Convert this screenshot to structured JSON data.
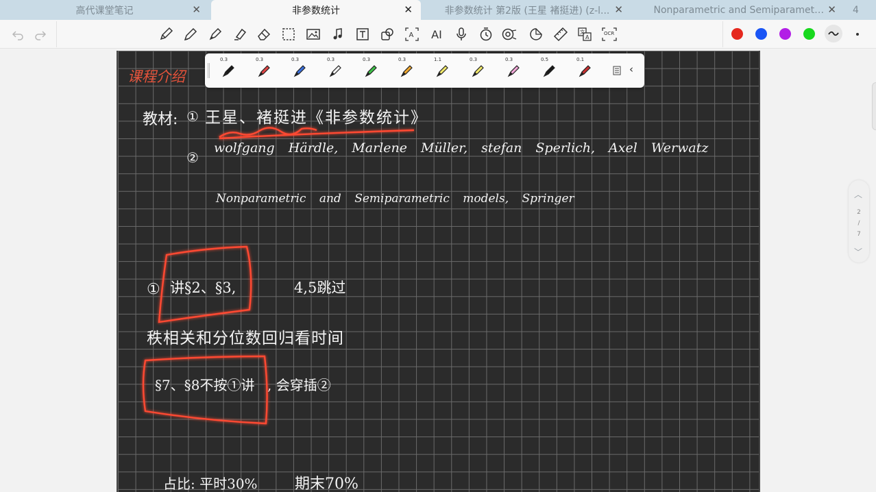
{
  "tabs": [
    {
      "label": "高代课堂笔记",
      "active": false
    },
    {
      "label": "非参数统计",
      "active": true
    },
    {
      "label": "非参数统计 第2版 (王星 褚挺进) (z-l...",
      "active": false
    },
    {
      "label": "Nonparametric and Semiparametri...",
      "active": false
    },
    {
      "label": "4",
      "active": false
    }
  ],
  "toolbar": {
    "tools": [
      "undo-icon",
      "redo-icon",
      "pencil-icon",
      "pen-icon",
      "marker-icon",
      "highlighter-icon",
      "eraser-icon",
      "lasso-select-icon",
      "image-icon",
      "music-note-icon",
      "text-box-icon",
      "shape-icon",
      "text-recognition-icon",
      "ai-icon",
      "microphone-icon",
      "timer-icon",
      "laser-icon",
      "sticker-icon",
      "ruler-icon",
      "translate-icon",
      "ocr-icon"
    ],
    "ocr_label": "OCR",
    "ai_label": "AI",
    "colors": [
      "#e5281e",
      "#1a55f5",
      "#b21ee6",
      "#18d81e"
    ]
  },
  "palette": {
    "pens": [
      {
        "size": "0.3",
        "color": "#1a1a1a"
      },
      {
        "size": "0.3",
        "color": "#e04545"
      },
      {
        "size": "0.3",
        "color": "#3a6fdc"
      },
      {
        "size": "0.3",
        "color": "#f5f5f5"
      },
      {
        "size": "0.3",
        "color": "#3fc24a"
      },
      {
        "size": "0.3",
        "color": "#f0a830"
      },
      {
        "size": "1.1",
        "color": "#f2e96a"
      },
      {
        "size": "0.3",
        "color": "#f2e96a"
      },
      {
        "size": "0.3",
        "color": "#f2a8d8"
      },
      {
        "size": "0.5",
        "color": "#1a1a1a"
      },
      {
        "size": "0.1",
        "color": "#c83030"
      }
    ]
  },
  "pagenav": {
    "current": "2",
    "sep": "/",
    "total": "7"
  },
  "note": {
    "heading": "课程介绍",
    "textbook_label": "教材:",
    "ref1_num": "①",
    "ref1_text": "王星、褚挺进《非参数统计》",
    "ref2_num": "②",
    "ref2_authors": "wolfgang Härdle, Marlene Müller, stefan Sperlich, Axel Werwatz",
    "ref2_title": "Nonparametric and Semiparametric models, Springer",
    "item1_num": "①",
    "item1_text": "讲§2、§3,",
    "item1_skip": "4,5跳过",
    "line_rank": "秩相关和分位数回归看时间",
    "item2_text": "§7、§8不按①讲",
    "item2_tail": ", 会穿插②",
    "grading": "占比: 平时30%",
    "grading_final": "期末70%"
  }
}
